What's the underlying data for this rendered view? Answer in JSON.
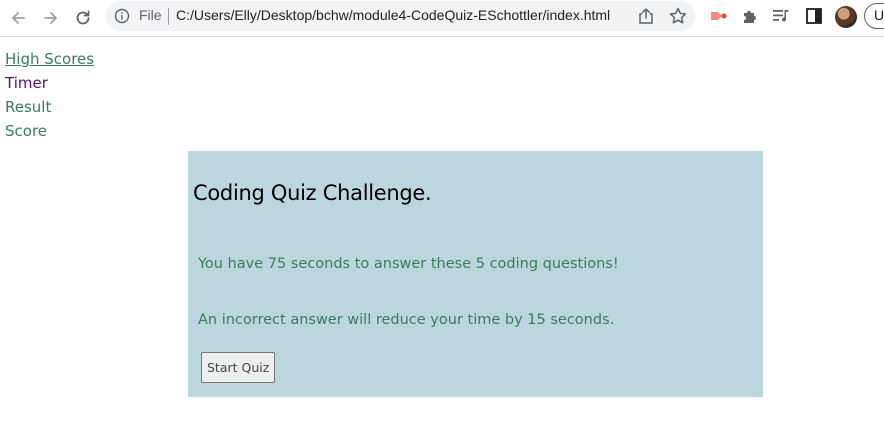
{
  "browser": {
    "file_label": "File",
    "url": "C:/Users/Elly/Desktop/bchw/module4-CodeQuiz-ESchottler/index.html",
    "profile_initial": "U",
    "icons": {
      "back": "back-arrow-icon",
      "forward": "forward-arrow-icon",
      "reload": "reload-icon",
      "info": "info-icon",
      "share": "share-icon",
      "bookmark": "star-icon",
      "extension_red": "extension-icon",
      "extensions": "puzzle-icon",
      "reading_list": "media-list-icon",
      "side_panel": "side-panel-icon"
    }
  },
  "nav": {
    "high_scores": "High Scores",
    "timer": "Timer",
    "result": "Result",
    "score": "Score"
  },
  "quiz": {
    "title": "Coding Quiz Challenge.",
    "intro": "You have 75 seconds to answer these 5 coding questions!",
    "penalty": "An incorrect answer will reduce your time by 15 seconds.",
    "start_button": "Start Quiz"
  },
  "colors": {
    "quiz_background": "#bcd6dd",
    "text_green": "#3a7d58",
    "timer_purple": "#5b0f6e"
  }
}
